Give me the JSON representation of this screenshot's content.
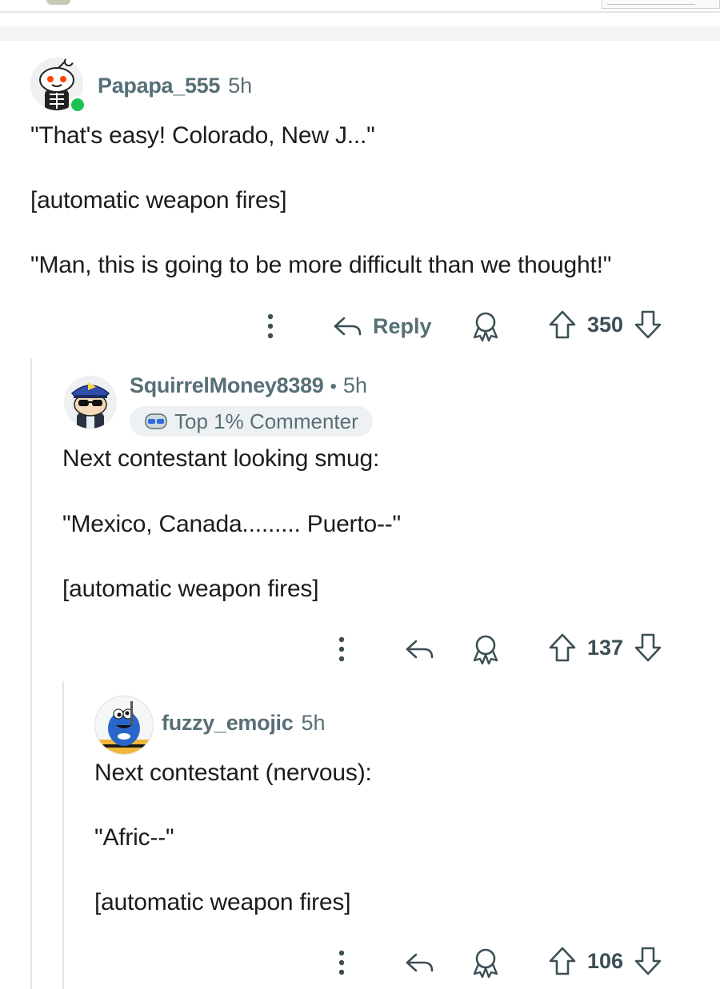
{
  "comments": [
    {
      "username": "Papapa_555",
      "time": "5h",
      "paragraphs": [
        "\"That's easy! Colorado, New J...\"",
        "[automatic weapon fires]",
        "\"Man, this is going to be more difficult than we thought!\""
      ],
      "reply_label": "Reply",
      "votes": "350",
      "online": true
    },
    {
      "username": "SquirrelMoney8389",
      "separator": "•",
      "time": "5h",
      "badge": "Top 1% Commenter",
      "paragraphs": [
        "Next contestant looking smug:",
        "\"Mexico, Canada......... Puerto--\"",
        "[automatic weapon fires]"
      ],
      "votes": "137"
    },
    {
      "username": "fuzzy_emojic",
      "time": "5h",
      "paragraphs": [
        "Next contestant (nervous):",
        "\"Afric--\"",
        "[automatic weapon fires]"
      ],
      "votes": "106"
    }
  ],
  "icons": {
    "more": "more-vertical-icon",
    "reply": "reply-arrow-icon",
    "award": "award-icon",
    "upvote": "upvote-arrow-icon",
    "downvote": "downvote-arrow-icon"
  },
  "colors": {
    "meta_text": "#576f76",
    "body_text": "#1c1c1c",
    "online": "#1bc451",
    "thread_line": "#e2e5e7"
  }
}
